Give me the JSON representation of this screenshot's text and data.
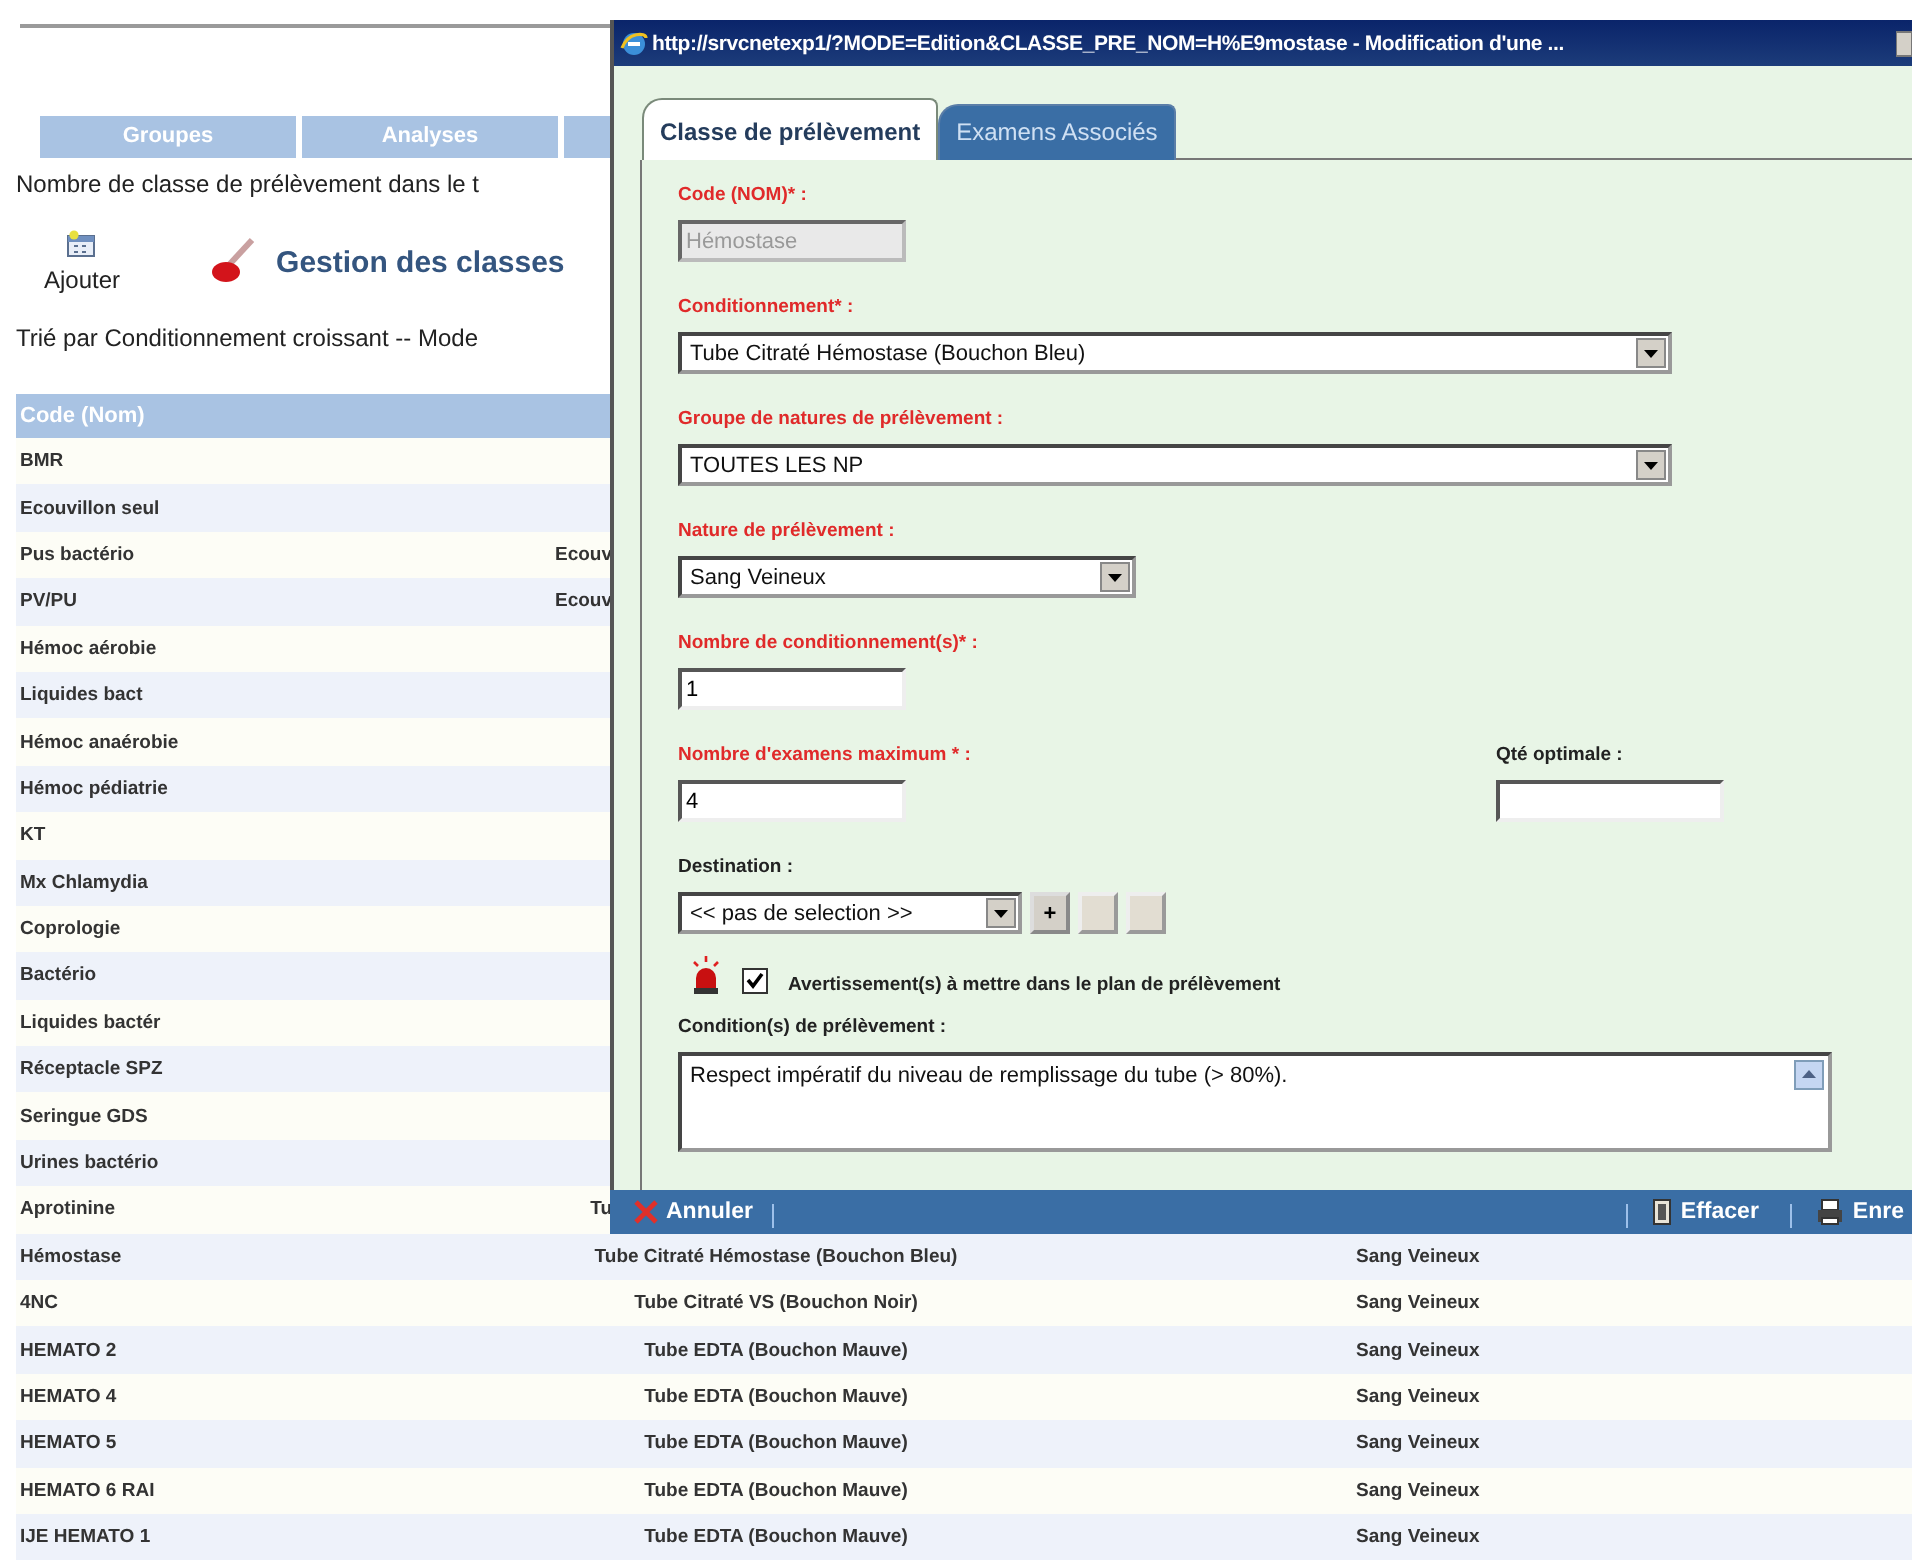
{
  "page": {
    "tabs": [
      {
        "label": "Groupes",
        "selected": false
      },
      {
        "label": "Analyses",
        "selected": false
      }
    ],
    "count_text": "Nombre de classe de prélèvement dans le t",
    "add_button": "Ajouter",
    "heading": "Gestion des classes",
    "sort_text": "Trié par Conditionnement croissant -- Mode",
    "table": {
      "columns": [
        "Code (Nom)"
      ],
      "rows": [
        {
          "code": "BMR"
        },
        {
          "code": "Ecouvillon seul"
        },
        {
          "code": "Pus bactério",
          "conditionnement": "Ecouv"
        },
        {
          "code": "PV/PU",
          "conditionnement": "Ecouv"
        },
        {
          "code": "Hémoc aérobie"
        },
        {
          "code": "Liquides bact"
        },
        {
          "code": "Hémoc anaérobie"
        },
        {
          "code": "Hémoc pédiatrie"
        },
        {
          "code": "KT"
        },
        {
          "code": "Mx Chlamydia"
        },
        {
          "code": "Coprologie"
        },
        {
          "code": "Bactério"
        },
        {
          "code": "Liquides bactér"
        },
        {
          "code": "Réceptacle SPZ"
        },
        {
          "code": "Seringue GDS"
        },
        {
          "code": "Urines bactério"
        },
        {
          "code": "Aprotinine",
          "conditionnement": "Tu"
        },
        {
          "code": "Hémostase",
          "conditionnement": "Tube Citraté Hémostase (Bouchon Bleu)",
          "nature": "Sang Veineux"
        },
        {
          "code": "4NC",
          "conditionnement": "Tube Citraté VS (Bouchon Noir)",
          "nature": "Sang Veineux"
        },
        {
          "code": "HEMATO 2",
          "conditionnement": "Tube EDTA (Bouchon Mauve)",
          "nature": "Sang Veineux"
        },
        {
          "code": "HEMATO 4",
          "conditionnement": "Tube EDTA (Bouchon Mauve)",
          "nature": "Sang Veineux"
        },
        {
          "code": "HEMATO 5",
          "conditionnement": "Tube EDTA (Bouchon Mauve)",
          "nature": "Sang Veineux"
        },
        {
          "code": "HEMATO 6 RAI",
          "conditionnement": "Tube EDTA (Bouchon Mauve)",
          "nature": "Sang Veineux"
        },
        {
          "code": "IJE HEMATO 1",
          "conditionnement": "Tube EDTA (Bouchon Mauve)",
          "nature": "Sang Veineux"
        }
      ]
    }
  },
  "popup": {
    "title": "http://srvcnetexp1/?MODE=Edition&CLASSE_PRE_NOM=H%E9mostase - Modification d'une ...",
    "tabs": [
      {
        "label": "Classe de prélèvement",
        "selected": true
      },
      {
        "label": "Examens Associés",
        "selected": false
      }
    ],
    "form_rows": [
      [
        {
          "kind": "text",
          "label": "Code (NOM)* :",
          "required": true,
          "value": "Hémostase",
          "disabled": true
        }
      ],
      [
        {
          "kind": "wide-select",
          "label": "Conditionnement* :",
          "required": true,
          "value": "Tube Citraté Hémostase (Bouchon Bleu)"
        }
      ],
      [
        {
          "kind": "wide-select",
          "label": "Groupe de natures de prélèvement :",
          "required": true,
          "value": "TOUTES LES NP"
        }
      ],
      [
        {
          "kind": "select",
          "label": "Nature de prélèvement :",
          "required": true,
          "value": "Sang Veineux"
        }
      ],
      [
        {
          "kind": "text",
          "label": "Nombre de conditionnement(s)* :",
          "required": true,
          "value": "1",
          "disabled": false
        }
      ],
      [
        {
          "kind": "text",
          "label": "Nombre d'examens maximum * :",
          "required": true,
          "value": "4",
          "disabled": false
        },
        {
          "kind": "text",
          "label": "Qté optimale :",
          "required": false,
          "disabled": false
        }
      ],
      [
        {
          "kind": "select-tools",
          "label": "Destination :",
          "required": false,
          "value": "<< pas de selection >>",
          "tools": [
            {
              "label": "+",
              "disabled": false
            },
            {
              "disabled": true
            },
            {
              "disabled": true
            }
          ]
        }
      ]
    ],
    "warning": {
      "checked": true,
      "label": "Avertissement(s) à mettre dans le plan de prélèvement"
    },
    "conditions": {
      "label": "Condition(s) de prélèvement :",
      "value": "Respect impératif du niveau de remplissage du tube (> 80%)."
    },
    "actions": [
      {
        "kind": "cancel",
        "label": "Annuler"
      },
      {
        "kind": "clear",
        "label": "Effacer"
      },
      {
        "kind": "save",
        "label": "Enre"
      }
    ]
  }
}
